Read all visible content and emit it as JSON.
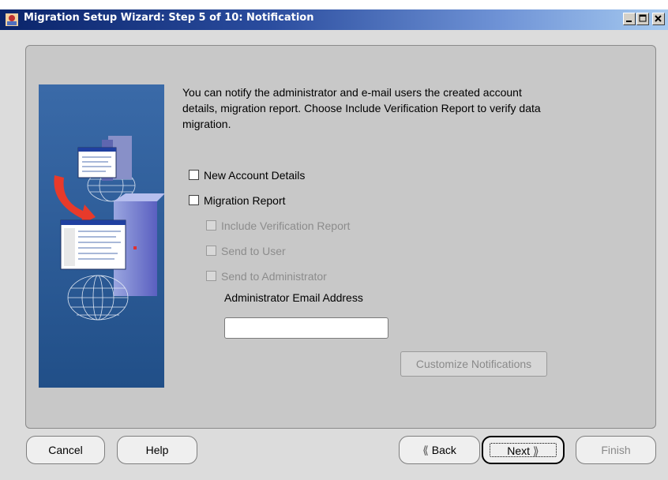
{
  "window": {
    "title": "Migration Setup Wizard: Step 5 of 10: Notification"
  },
  "description": "You can notify the administrator and e-mail users the created account details, migration report. Choose Include Verification Report to verify data migration.",
  "options": [
    {
      "label": "New Account Details",
      "checked": false,
      "enabled": true
    },
    {
      "label": "Migration Report",
      "checked": false,
      "enabled": true
    },
    {
      "label": "Include Verification Report",
      "checked": false,
      "enabled": false
    },
    {
      "label": "Send to User",
      "checked": false,
      "enabled": false
    },
    {
      "label": "Send to Administrator",
      "checked": false,
      "enabled": false
    }
  ],
  "admin_email": {
    "label": "Administrator Email Address",
    "value": ""
  },
  "customize_button": "Customize Notifications",
  "buttons": {
    "cancel": "Cancel",
    "help": "Help",
    "back": "Back",
    "next": "Next",
    "finish": "Finish"
  },
  "colors": {
    "titlebar_start": "#0a246a",
    "titlebar_end": "#a6caf0",
    "panel": "#c8c8c8",
    "illustration_bg": "#2f5d96"
  }
}
